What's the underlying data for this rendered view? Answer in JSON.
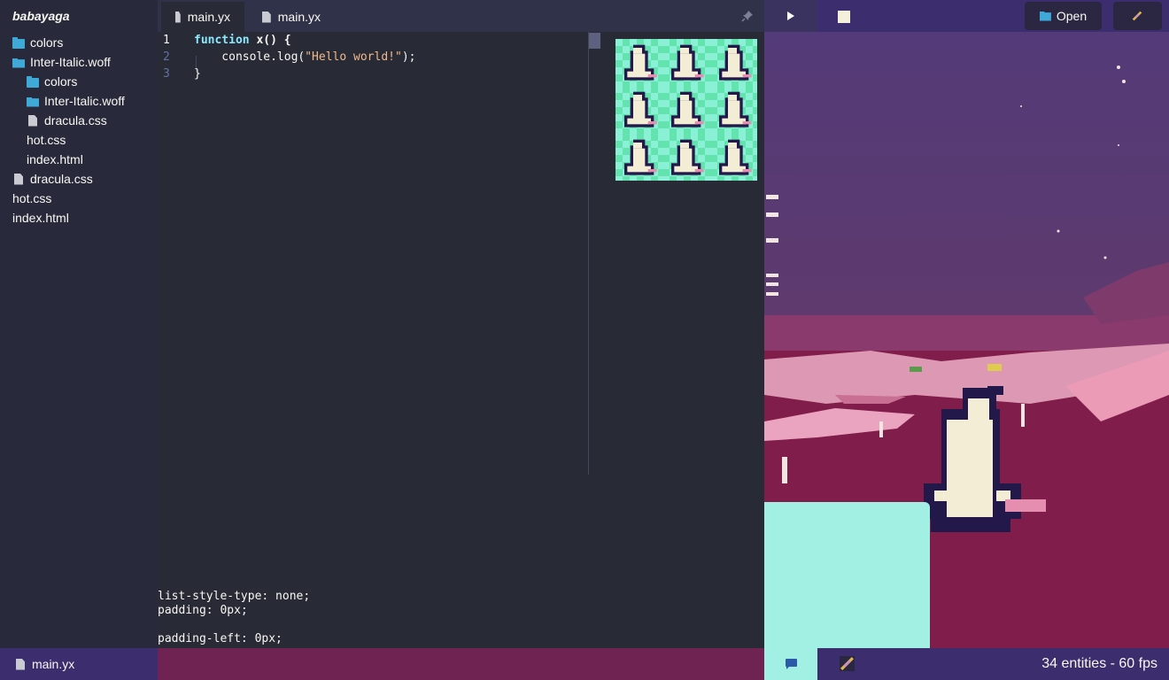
{
  "sidebar": {
    "title": "babayaga",
    "items": [
      {
        "label": "colors",
        "icon": "folder-icon"
      },
      {
        "label": "Inter-Italic.woff",
        "icon": "folder-open-icon"
      },
      {
        "label": "colors",
        "icon": "folder-icon"
      },
      {
        "label": "Inter-Italic.woff",
        "icon": "folder-open-icon"
      },
      {
        "label": "dracula.css",
        "icon": "file-icon"
      },
      {
        "label": "hot.css",
        "icon": "none"
      },
      {
        "label": "index.html",
        "icon": "none"
      },
      {
        "label": "dracula.css",
        "icon": "file-icon"
      },
      {
        "label": "hot.css",
        "icon": "none"
      },
      {
        "label": "index.html",
        "icon": "none"
      }
    ]
  },
  "tabs": [
    {
      "label": "main.yx",
      "active": true
    },
    {
      "label": "main.yx",
      "active": false
    }
  ],
  "editor": {
    "line_numbers": [
      "1",
      "2",
      "3"
    ],
    "lines": {
      "l1_kw": "function",
      "l1_fn": "x() {",
      "l2_pre": "    console.log(",
      "l2_str": "\"Hello world!\"",
      "l2_post": ");",
      "l3": "}"
    }
  },
  "css_lines": [
    "list-style-type: none;",
    "padding: 0px;",
    "padding-left: 0px;"
  ],
  "toolbar": {
    "open_label": "Open"
  },
  "statusbar": {
    "file_label": "main.yx",
    "stats": "34 entities - 60 fps"
  },
  "colors": {
    "sidebar": "#282a3c",
    "editor": "#282a36",
    "accent_purple": "#3c2d6e",
    "status_magenta": "#6e2352",
    "mint": "#a2efe3",
    "keyword": "#8be9fd",
    "string": "#f1b98c"
  }
}
